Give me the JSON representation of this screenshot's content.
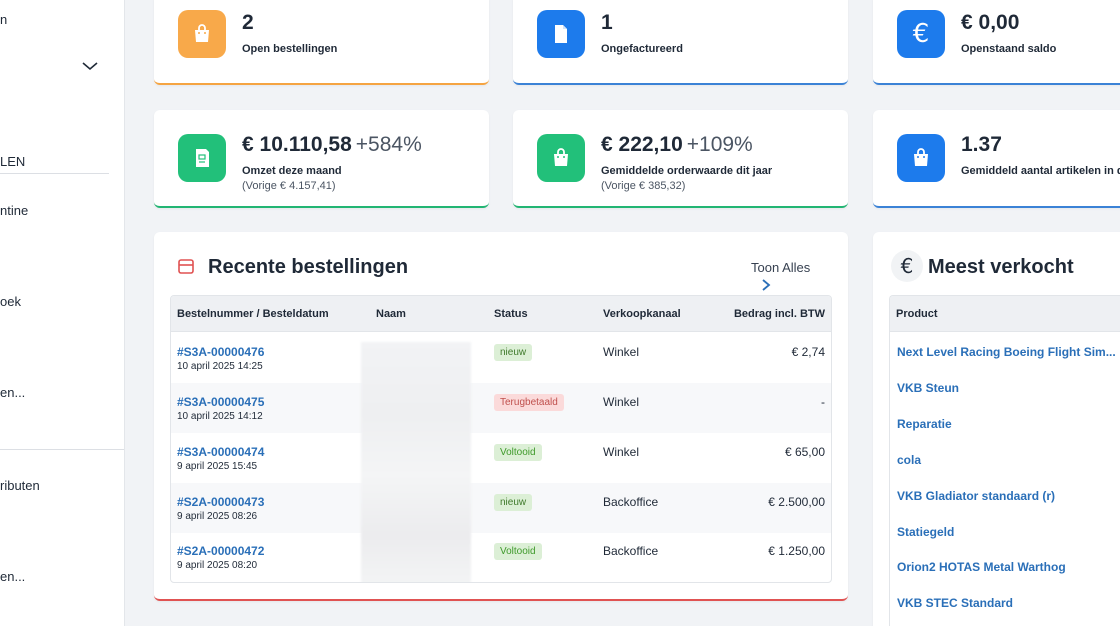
{
  "sidebar": {
    "items": [
      {
        "label": "n"
      },
      {
        "label": "LEN"
      },
      {
        "label": "ntine"
      },
      {
        "label": "oek"
      },
      {
        "label": "en..."
      },
      {
        "label": "ributen"
      },
      {
        "label": "en..."
      }
    ]
  },
  "stats_row1": [
    {
      "value": "2",
      "label": "Open bestellingen"
    },
    {
      "value": "1",
      "label": "Ongefactureerd"
    },
    {
      "value": "€ 0,00",
      "label": "Openstaand saldo",
      "icon_char": "€"
    }
  ],
  "stats_row2": [
    {
      "value": "€ 10.110,58",
      "change": "+584%",
      "label": "Omzet deze maand",
      "prev": "(Vorige € 4.157,41)"
    },
    {
      "value": "€ 222,10",
      "change": "+109%",
      "label": "Gemiddelde orderwaarde dit jaar",
      "prev": "(Vorige € 385,32)"
    },
    {
      "value": "1.37",
      "label": "Gemiddeld aantal artikelen in de"
    }
  ],
  "recent": {
    "title": "Recente bestellingen",
    "show_all": "Toon Alles",
    "columns": [
      "Bestelnummer / Besteldatum",
      "Naam",
      "Status",
      "Verkoopkanaal",
      "Bedrag incl. BTW"
    ],
    "rows": [
      {
        "number": "#S3A-00000476",
        "date": "10 april 2025 14:25",
        "status": "nieuw",
        "channel": "Winkel",
        "amount": "€ 2,74"
      },
      {
        "number": "#S3A-00000475",
        "date": "10 april 2025 14:12",
        "status": "Terugbetaald",
        "channel": "Winkel",
        "amount": "-"
      },
      {
        "number": "#S3A-00000474",
        "date": "9 april 2025 15:45",
        "status": "Voltooid",
        "channel": "Winkel",
        "amount": "€ 65,00"
      },
      {
        "number": "#S2A-00000473",
        "date": "9 april 2025 08:26",
        "status": "nieuw",
        "channel": "Backoffice",
        "amount": "€ 2.500,00"
      },
      {
        "number": "#S2A-00000472",
        "date": "9 april 2025 08:20",
        "status": "Voltooid",
        "channel": "Backoffice",
        "amount": "€ 1.250,00"
      }
    ]
  },
  "best_sellers": {
    "title": "Meest verkocht",
    "icon_char": "€",
    "column": "Product",
    "products": [
      "Next Level Racing Boeing Flight Sim...",
      "VKB Steun",
      "Reparatie",
      "cola",
      "VKB Gladiator standaard (r)",
      "Statiegeld",
      "Orion2 HOTAS Metal Warthog",
      "VKB STEC Standard"
    ]
  },
  "colors": {
    "orange": "#f8a94a",
    "blue": "#1d7bec",
    "green": "#22c07a",
    "red": "#e05252",
    "link": "#2a6fb8"
  }
}
